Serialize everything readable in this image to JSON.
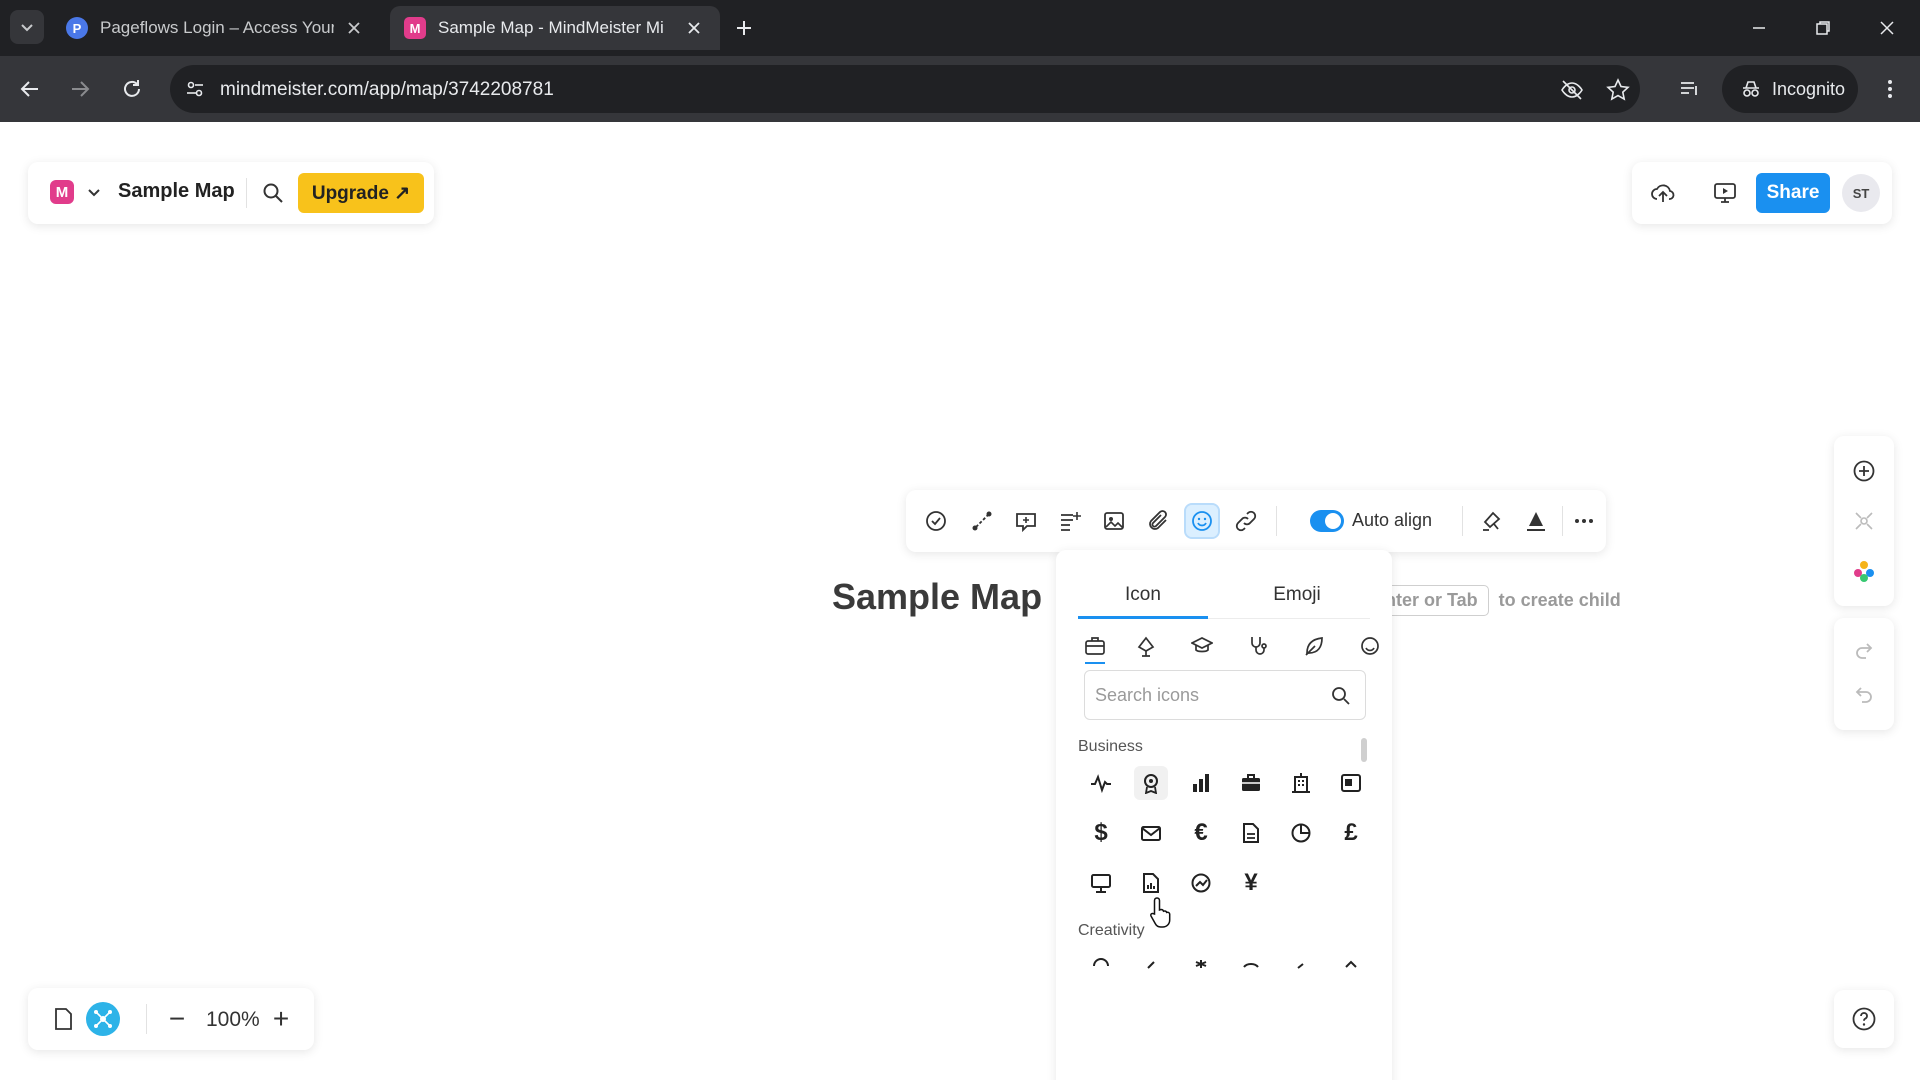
{
  "browser": {
    "tabs": [
      {
        "title": "Pageflows Login – Access Your",
        "favicon": "P",
        "active": false
      },
      {
        "title": "Sample Map - MindMeister Mi",
        "favicon": "M",
        "active": true
      }
    ],
    "url": "mindmeister.com/app/map/3742208781",
    "incognito_label": "Incognito"
  },
  "app": {
    "logo_letter": "M",
    "map_title": "Sample Map",
    "upgrade_label": "Upgrade ↗",
    "share_label": "Share",
    "avatar_initials": "ST",
    "zoom_level": "100%",
    "zoom_minus": "−",
    "zoom_plus": "+"
  },
  "canvas": {
    "root_node_title": "Sample Map",
    "hint_key": "nter or Tab",
    "hint_text": "to create child"
  },
  "toolbar": {
    "auto_align_label": "Auto align",
    "auto_align_enabled": true,
    "selected_tool": "icon-emoji"
  },
  "picker": {
    "tabs": [
      "Icon",
      "Emoji"
    ],
    "active_tab": "Icon",
    "search_placeholder": "Search icons",
    "sections": [
      "Business",
      "Creativity"
    ],
    "business_icons": [
      "pulse-icon",
      "gear-badge-icon",
      "bar-chart-icon",
      "briefcase-icon",
      "building-icon",
      "id-card-icon",
      "dollar-icon",
      "mail-icon",
      "euro-icon",
      "document-icon",
      "pie-chart-icon",
      "pound-icon",
      "monitor-icon",
      "report-icon",
      "trend-icon",
      "yen-icon"
    ],
    "glyphs": {
      "dollar": "$",
      "euro": "€",
      "pound": "£",
      "yen": "¥"
    }
  },
  "colors": {
    "accent": "#1a90f0",
    "upgrade": "#f8c21b",
    "brand": "#e13c8b"
  }
}
